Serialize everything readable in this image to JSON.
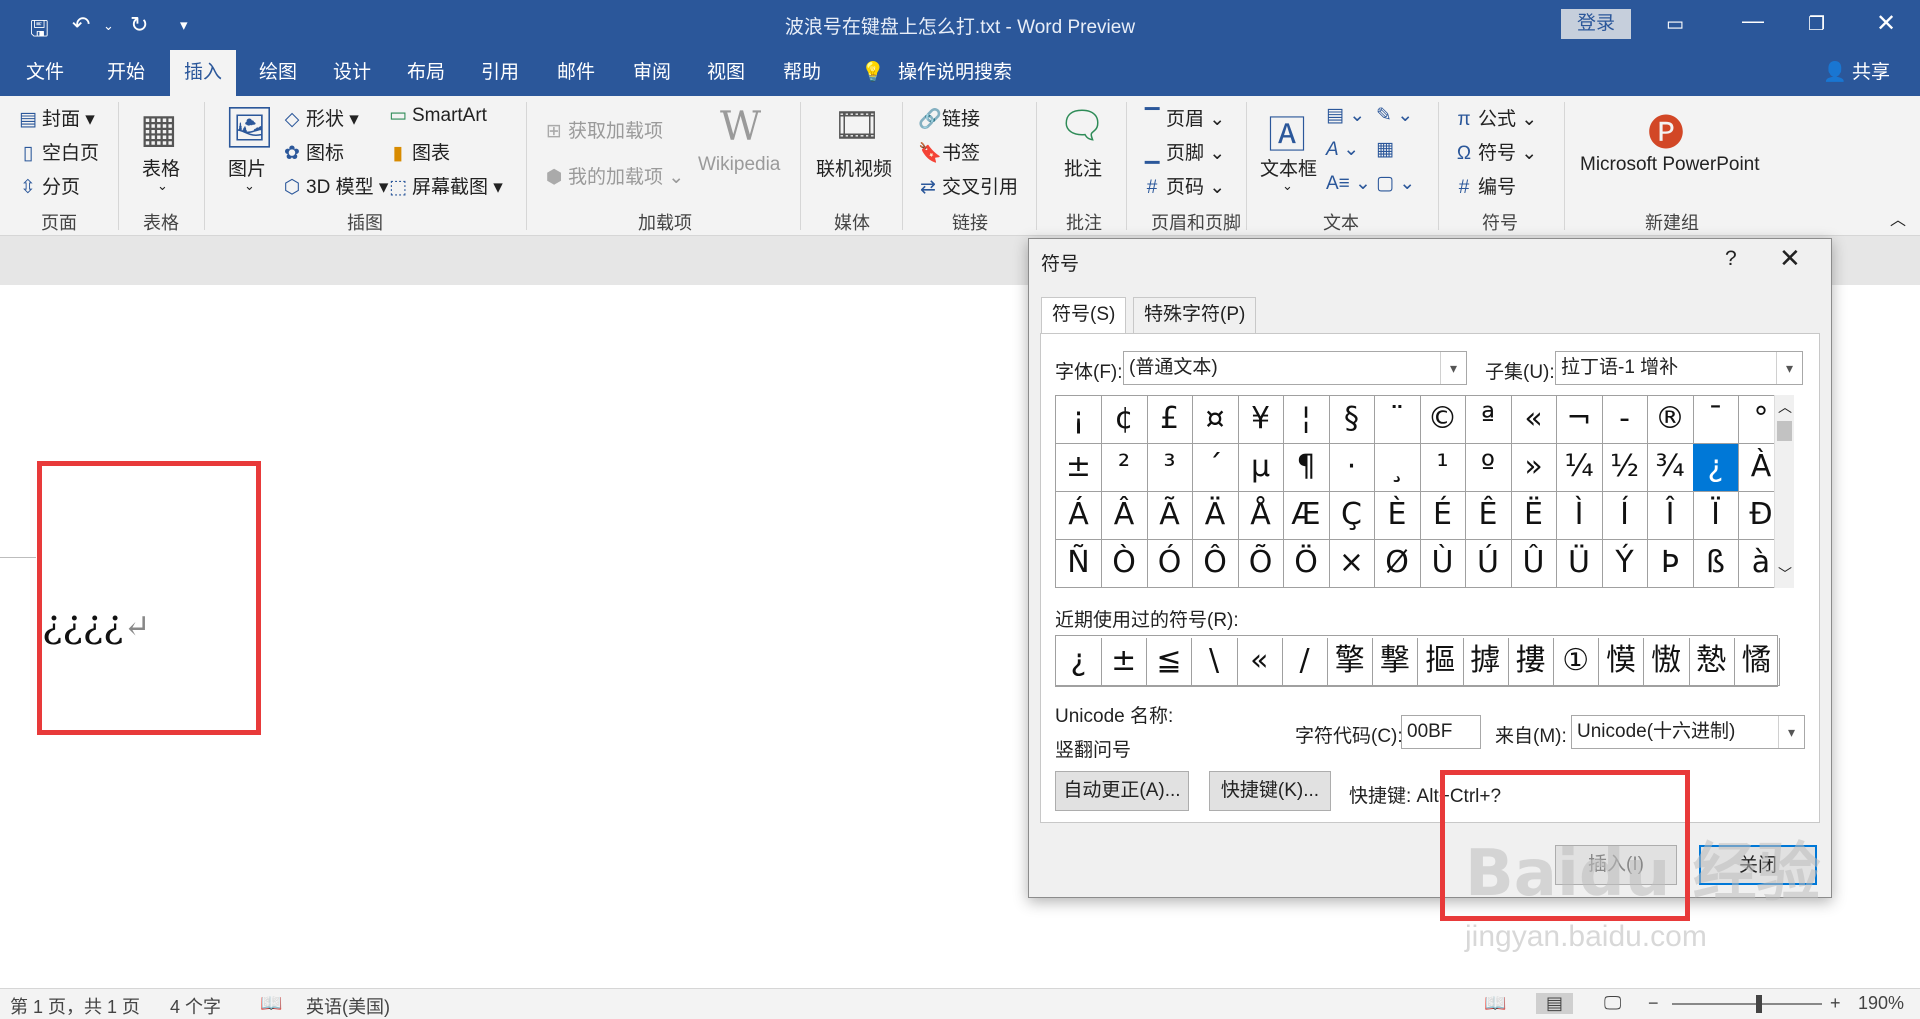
{
  "app": {
    "doc_title": "波浪号在键盘上怎么打.txt  -  Word Preview",
    "login": "登录",
    "share": "共享"
  },
  "menu": {
    "tabs": [
      "文件",
      "开始",
      "插入",
      "绘图",
      "设计",
      "布局",
      "引用",
      "邮件",
      "审阅",
      "视图",
      "帮助"
    ],
    "active": "插入",
    "tell_me": "操作说明搜索"
  },
  "ribbon": {
    "pages": {
      "cover": "封面",
      "blank": "空白页",
      "break": "分页",
      "label": "页面"
    },
    "tables": {
      "table": "表格",
      "label": "表格"
    },
    "illustrations": {
      "pictures": "图片",
      "shapes": "形状",
      "icons": "图标",
      "model3d": "3D 模型",
      "smartart": "SmartArt",
      "chart": "图表",
      "screenshot": "屏幕截图",
      "label": "插图"
    },
    "addins": {
      "get": "获取加载项",
      "my": "我的加载项",
      "wikipedia": "Wikipedia",
      "label": "加载项"
    },
    "media": {
      "video": "联机视频",
      "label": "媒体"
    },
    "links": {
      "link": "链接",
      "bookmark": "书签",
      "crossref": "交叉引用",
      "label": "链接"
    },
    "comments": {
      "comment": "批注",
      "label": "批注"
    },
    "header_footer": {
      "header": "页眉",
      "footer": "页脚",
      "page_number": "页码",
      "label": "页眉和页脚"
    },
    "text": {
      "textbox": "文本框",
      "label": "文本"
    },
    "symbols": {
      "equation": "公式",
      "symbol": "符号",
      "number": "编号",
      "label": "符号"
    },
    "newgroup": {
      "ppt": "Microsoft PowerPoint",
      "label": "新建组"
    }
  },
  "document": {
    "text": "¿¿¿¿",
    "para_mark": "↵"
  },
  "status": {
    "page": "第 1 页，共 1 页",
    "words": "4 个字",
    "language": "英语(美国)",
    "zoom": "190%"
  },
  "dialog": {
    "title": "符号",
    "help": "?",
    "close_x": "✕",
    "tabs": [
      "符号(S)",
      "特殊字符(P)"
    ],
    "font_label": "字体(F):",
    "font_value": "(普通文本)",
    "subset_label": "子集(U):",
    "subset_value": "拉丁语-1 增补",
    "grid": [
      [
        "¡",
        "¢",
        "£",
        "¤",
        "¥",
        "¦",
        "§",
        "¨",
        "©",
        "ª",
        "«",
        "¬",
        "-",
        "®",
        "¯",
        "°"
      ],
      [
        "±",
        "²",
        "³",
        "´",
        "µ",
        "¶",
        "·",
        "¸",
        "¹",
        "º",
        "»",
        "¼",
        "½",
        "¾",
        "¿",
        "À"
      ],
      [
        "Á",
        "Â",
        "Ã",
        "Ä",
        "Å",
        "Æ",
        "Ç",
        "È",
        "É",
        "Ê",
        "Ë",
        "Ì",
        "Í",
        "Î",
        "Ï",
        "Ð"
      ],
      [
        "Ñ",
        "Ò",
        "Ó",
        "Ô",
        "Õ",
        "Ö",
        "×",
        "Ø",
        "Ù",
        "Ú",
        "Û",
        "Ü",
        "Ý",
        "Þ",
        "ß",
        "à"
      ]
    ],
    "selected": "¿",
    "recent_label": "近期使用过的符号(R):",
    "recent": [
      "¿",
      "±",
      "≦",
      "\\",
      "«",
      "/",
      "擎",
      "撃",
      "摳",
      "摢",
      "摟",
      "①",
      "慔",
      "慠",
      "慹",
      "憰"
    ],
    "unicode_name_label": "Unicode 名称:",
    "unicode_name": "竖翻问号",
    "char_code_label": "字符代码(C):",
    "char_code": "00BF",
    "from_label": "来自(M):",
    "from_value": "Unicode(十六进制)",
    "autocorrect": "自动更正(A)...",
    "shortcut_btn": "快捷键(K)...",
    "shortcut_text": "快捷键: Alt+Ctrl+?",
    "insert": "插入(I)",
    "close": "关闭"
  },
  "watermark": {
    "main": "Baidu 经验",
    "sub": "jingyan.baidu.com"
  }
}
